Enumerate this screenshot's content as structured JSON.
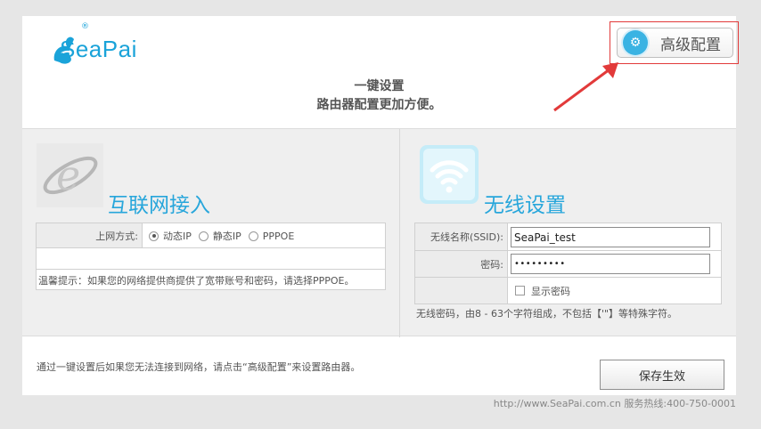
{
  "brand": {
    "logo_text": "SeaPai",
    "logo_reg": "®"
  },
  "header": {
    "advanced_button": "高级配置",
    "title_line1": "一键设置",
    "title_line2": "路由器配置更加方便。"
  },
  "internet": {
    "title": "互联网接入",
    "mode_label": "上网方式:",
    "options": [
      "动态IP",
      "静态IP",
      "PPPOE"
    ],
    "selected_option": "动态IP",
    "hint": "温馨提示：如果您的网络提供商提供了宽带账号和密码，请选择PPPOE。"
  },
  "wireless": {
    "title": "无线设置",
    "ssid_label": "无线名称(SSID):",
    "ssid_value": "SeaPai_test",
    "password_label": "密码:",
    "password_value": "•••••••••",
    "show_password_label": "显示密码",
    "hint": "无线密码，由8 - 63个字符组成，不包括【'\"】等特殊字符。"
  },
  "footer": {
    "note": "通过一键设置后如果您无法连接到网络，请点击“高级配置”来设置路由器。",
    "save_button": "保存生效",
    "contact": "http://www.SeaPai.com.cn 服务热线:400-750-0001"
  },
  "colors": {
    "accent": "#27a6db",
    "highlight": "#e23a3a"
  }
}
